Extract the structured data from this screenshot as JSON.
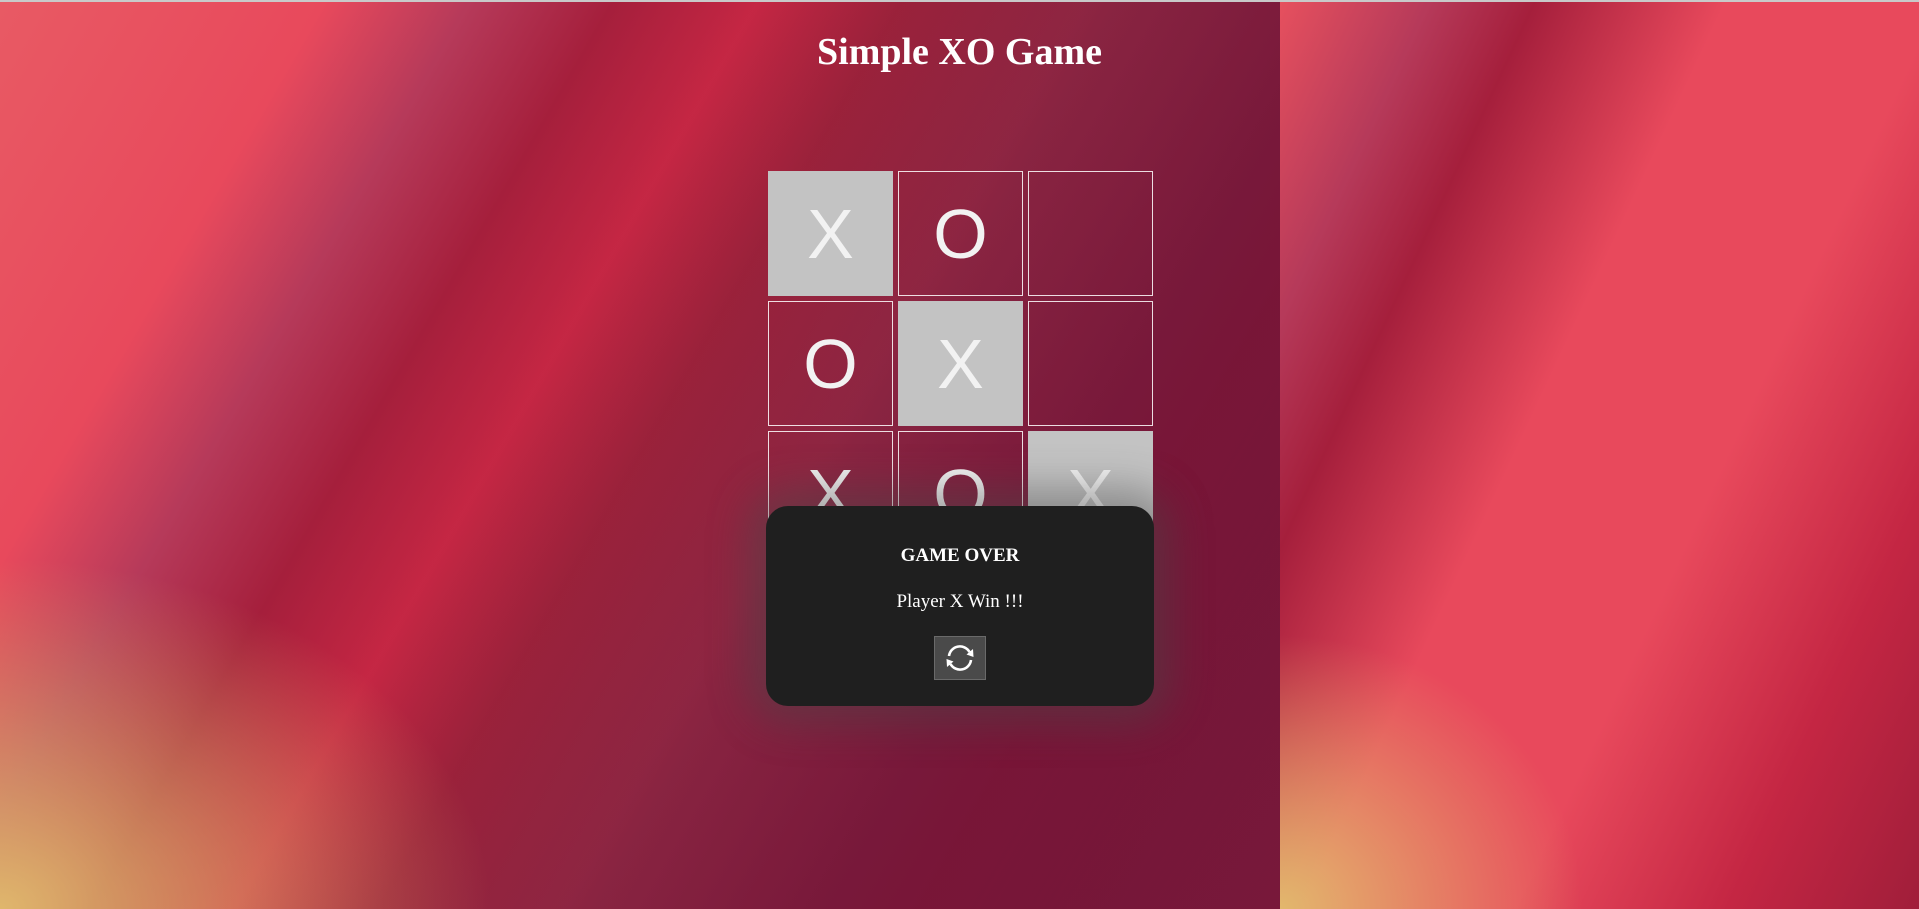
{
  "page": {
    "title": "Simple XO Game"
  },
  "board": {
    "cells": [
      {
        "mark": "X",
        "highlight": true
      },
      {
        "mark": "O",
        "highlight": false
      },
      {
        "mark": "",
        "highlight": false
      },
      {
        "mark": "O",
        "highlight": false
      },
      {
        "mark": "X",
        "highlight": true
      },
      {
        "mark": "",
        "highlight": false
      },
      {
        "mark": "X",
        "highlight": false
      },
      {
        "mark": "O",
        "highlight": false
      },
      {
        "mark": "X",
        "highlight": true
      }
    ],
    "highlight_color": "#c3c3c3"
  },
  "modal": {
    "title": "GAME OVER",
    "message": "Player X Win !!!",
    "restart_icon": "refresh-icon",
    "background_color": "#1f1f1f"
  }
}
